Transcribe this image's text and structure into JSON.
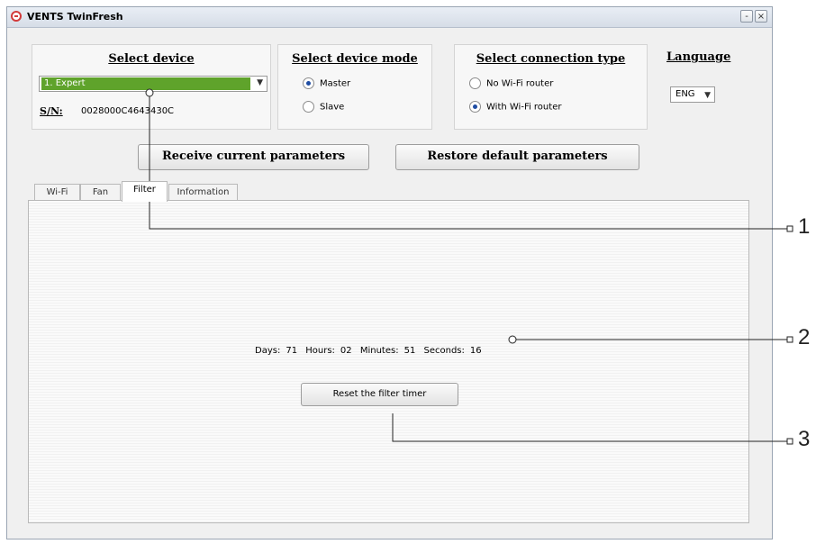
{
  "window": {
    "title": "VENTS TwinFresh",
    "minimize": "-",
    "close": "×"
  },
  "device": {
    "title": "Select device",
    "selected": "1. Expert",
    "sn_label": "S/N:",
    "sn_value": "0028000C4643430C"
  },
  "mode": {
    "title": "Select device mode",
    "options": [
      {
        "label": "Master",
        "checked": true
      },
      {
        "label": "Slave",
        "checked": false
      }
    ]
  },
  "connection": {
    "title": "Select connection type",
    "options": [
      {
        "label": "No Wi-Fi router",
        "checked": false
      },
      {
        "label": "With Wi-Fi router",
        "checked": true
      }
    ]
  },
  "language": {
    "title": "Language",
    "selected": "ENG"
  },
  "buttons": {
    "receive": "Receive current parameters",
    "restore": "Restore default parameters",
    "reset_filter": "Reset the filter timer"
  },
  "tabs": [
    {
      "label": "Wi-Fi",
      "active": false
    },
    {
      "label": "Fan",
      "active": false
    },
    {
      "label": "Filter",
      "active": true
    },
    {
      "label": "Information",
      "active": false
    }
  ],
  "timer": {
    "days_label": "Days:",
    "days": "71",
    "hours_label": "Hours:",
    "hours": "02",
    "minutes_label": "Minutes:",
    "minutes": "51",
    "seconds_label": "Seconds:",
    "seconds": "16"
  },
  "callouts": [
    "1",
    "2",
    "3"
  ],
  "colors": {
    "selected_device_bg": "#5fa32b",
    "radio_dot": "#1f4da3"
  }
}
